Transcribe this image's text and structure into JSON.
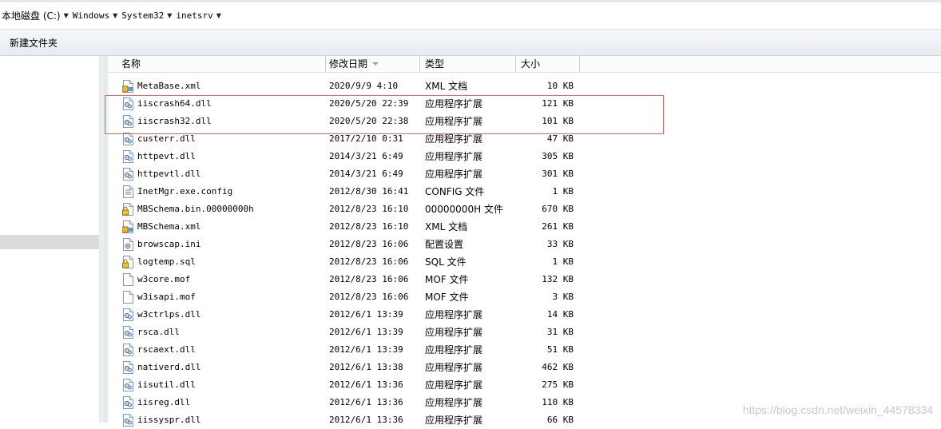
{
  "address": {
    "crumbs": [
      "本地磁盘 (C:)",
      "Windows",
      "System32",
      "inetsrv"
    ]
  },
  "toolbar": {
    "new_folder": "新建文件夹"
  },
  "columns": {
    "name": "名称",
    "date": "修改日期",
    "type": "类型",
    "size": "大小"
  },
  "files": [
    {
      "name": "MetaBase.xml",
      "date": "2020/9/9 4:10",
      "type": "XML 文档",
      "size": "10 KB",
      "icon": "xml-file-icon"
    },
    {
      "name": "iiscrash64.dll",
      "date": "2020/5/20 22:39",
      "type": "应用程序扩展",
      "size": "121 KB",
      "icon": "dll-file-icon"
    },
    {
      "name": "iiscrash32.dll",
      "date": "2020/5/20 22:38",
      "type": "应用程序扩展",
      "size": "101 KB",
      "icon": "dll-file-icon"
    },
    {
      "name": "custerr.dll",
      "date": "2017/2/10 0:31",
      "type": "应用程序扩展",
      "size": "47 KB",
      "icon": "dll-file-icon"
    },
    {
      "name": "httpevt.dll",
      "date": "2014/3/21 6:49",
      "type": "应用程序扩展",
      "size": "305 KB",
      "icon": "dll-file-icon"
    },
    {
      "name": "httpevtl.dll",
      "date": "2014/3/21 6:49",
      "type": "应用程序扩展",
      "size": "301 KB",
      "icon": "dll-file-icon"
    },
    {
      "name": "InetMgr.exe.config",
      "date": "2012/8/30 16:41",
      "type": "CONFIG 文件",
      "size": "1 KB",
      "icon": "config-file-icon"
    },
    {
      "name": "MBSchema.bin.00000000h",
      "date": "2012/8/23 16:10",
      "type": "00000000H 文件",
      "size": "670 KB",
      "icon": "locked-file-icon"
    },
    {
      "name": "MBSchema.xml",
      "date": "2012/8/23 16:10",
      "type": "XML 文档",
      "size": "261 KB",
      "icon": "xml-file-icon"
    },
    {
      "name": "browscap.ini",
      "date": "2012/8/23 16:06",
      "type": "配置设置",
      "size": "33 KB",
      "icon": "ini-file-icon"
    },
    {
      "name": "logtemp.sql",
      "date": "2012/8/23 16:06",
      "type": "SQL 文件",
      "size": "1 KB",
      "icon": "locked-file-icon"
    },
    {
      "name": "w3core.mof",
      "date": "2012/8/23 16:06",
      "type": "MOF 文件",
      "size": "132 KB",
      "icon": "blank-file-icon"
    },
    {
      "name": "w3isapi.mof",
      "date": "2012/8/23 16:06",
      "type": "MOF 文件",
      "size": "3 KB",
      "icon": "blank-file-icon"
    },
    {
      "name": "w3ctrlps.dll",
      "date": "2012/6/1 13:39",
      "type": "应用程序扩展",
      "size": "14 KB",
      "icon": "dll-file-icon"
    },
    {
      "name": "rsca.dll",
      "date": "2012/6/1 13:39",
      "type": "应用程序扩展",
      "size": "31 KB",
      "icon": "dll-file-icon"
    },
    {
      "name": "rscaext.dll",
      "date": "2012/6/1 13:39",
      "type": "应用程序扩展",
      "size": "51 KB",
      "icon": "dll-file-icon"
    },
    {
      "name": "nativerd.dll",
      "date": "2012/6/1 13:38",
      "type": "应用程序扩展",
      "size": "462 KB",
      "icon": "dll-file-icon"
    },
    {
      "name": "iisutil.dll",
      "date": "2012/6/1 13:36",
      "type": "应用程序扩展",
      "size": "275 KB",
      "icon": "dll-file-icon"
    },
    {
      "name": "iisreg.dll",
      "date": "2012/6/1 13:36",
      "type": "应用程序扩展",
      "size": "110 KB",
      "icon": "dll-file-icon"
    },
    {
      "name": "iissyspr.dll",
      "date": "2012/6/1 13:36",
      "type": "应用程序扩展",
      "size": "66 KB",
      "icon": "dll-file-icon"
    }
  ],
  "watermark": "https://blog.csdn.net/weixin_44578334"
}
